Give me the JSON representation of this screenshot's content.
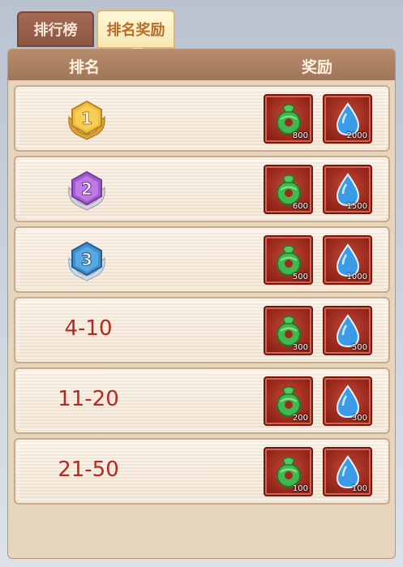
{
  "tabs": [
    {
      "label": "排行榜",
      "active": false
    },
    {
      "label": "排名奖励",
      "active": true
    }
  ],
  "header": {
    "rank_label": "排名",
    "reward_label": "奖励"
  },
  "rows": [
    {
      "rank": "1",
      "rank_display": "medal-gold",
      "jade": "800",
      "water": "2000"
    },
    {
      "rank": "2",
      "rank_display": "medal-purple",
      "jade": "600",
      "water": "1500"
    },
    {
      "rank": "3",
      "rank_display": "medal-blue",
      "jade": "500",
      "water": "1000"
    },
    {
      "rank": "4-10",
      "rank_display": "text",
      "jade": "300",
      "water": "500"
    },
    {
      "rank": "11-20",
      "rank_display": "text",
      "jade": "200",
      "water": "300"
    },
    {
      "rank": "21-50",
      "rank_display": "text",
      "jade": "100",
      "water": "100"
    }
  ],
  "icons": {
    "reward_1": "jade-pendant-icon",
    "reward_2": "water-drop-icon"
  },
  "colors": {
    "medal_gold": "#e4a72b",
    "medal_purple": "#a45bd0",
    "medal_blue": "#3d8fcf",
    "rank_text": "#b52a20"
  }
}
